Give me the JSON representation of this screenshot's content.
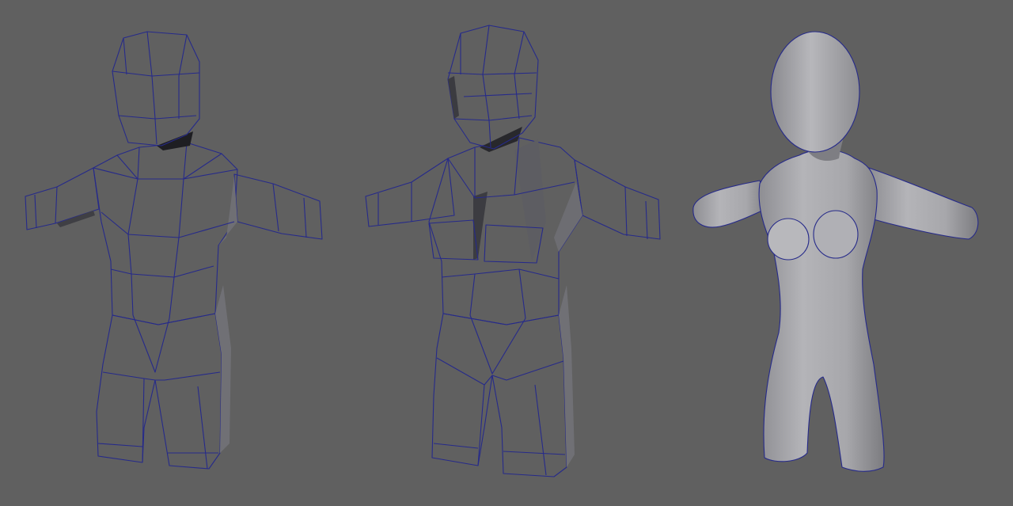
{
  "scene": {
    "background": "#606060",
    "mesh_fill": "#a9a9ad",
    "mesh_light": "#bdbdc2",
    "mesh_shade": "#7d7d82",
    "mesh_dark": "#2a2a2e",
    "wire_color": "#262a8a",
    "models": [
      {
        "id": "low-poly-base"
      },
      {
        "id": "low-poly-refined"
      },
      {
        "id": "subdivided-female"
      }
    ]
  }
}
